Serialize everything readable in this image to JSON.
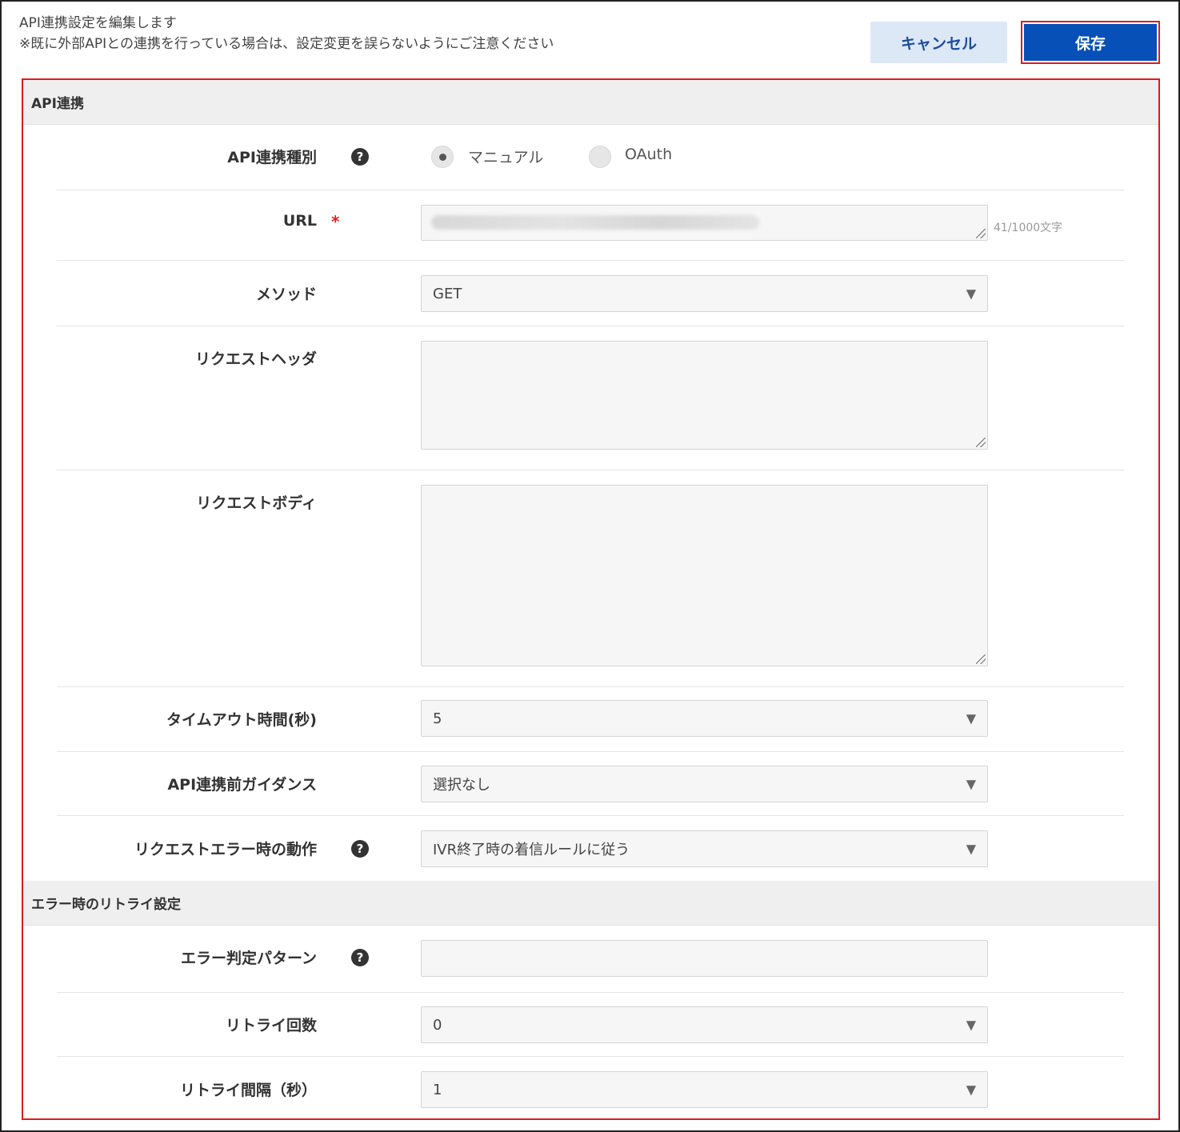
{
  "header": {
    "line1": "API連携設定を編集します",
    "line2": "※既に外部APIとの連携を行っている場合は、設定変更を誤らないようにご注意ください",
    "cancel_label": "キャンセル",
    "save_label": "保存"
  },
  "section_api": {
    "title": "API連携",
    "type_label": "API連携種別",
    "type_options": [
      "マニュアル",
      "OAuth"
    ],
    "type_selected": "マニュアル",
    "url_label": "URL",
    "url_required_mark": "*",
    "url_counter": "41/1000文字",
    "method_label": "メソッド",
    "method_value": "GET",
    "request_header_label": "リクエストヘッダ",
    "request_header_value": "",
    "request_body_label": "リクエストボディ",
    "request_body_value": "",
    "timeout_label": "タイムアウト時間(秒)",
    "timeout_value": "5",
    "guidance_label": "API連携前ガイダンス",
    "guidance_value": "選択なし",
    "error_action_label": "リクエストエラー時の動作",
    "error_action_value": "IVR終了時の着信ルールに従う"
  },
  "section_retry": {
    "title": "エラー時のリトライ設定",
    "pattern_label": "エラー判定パターン",
    "pattern_value": "",
    "count_label": "リトライ回数",
    "count_value": "0",
    "interval_label": "リトライ間隔（秒）",
    "interval_value": "1"
  },
  "icons": {
    "help": "question-circle-icon",
    "caret": "caret-down-icon",
    "help_glyph": "?",
    "caret_glyph": "▼"
  },
  "colors": {
    "accent_red": "#e01b1b",
    "save_blue": "#0650b8",
    "cancel_bg": "#dde8f7"
  }
}
